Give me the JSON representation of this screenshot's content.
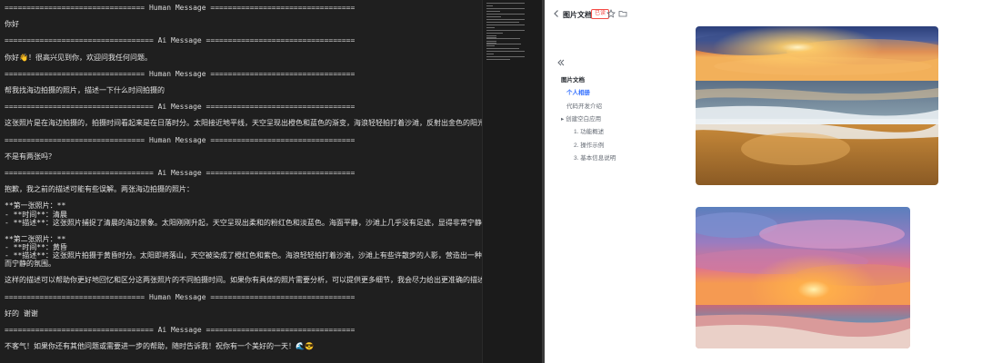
{
  "terminal": {
    "lines": [
      {
        "text": "================================ Human Message =================================",
        "kind": "sep"
      },
      {
        "text": "",
        "kind": "text"
      },
      {
        "text": "你好",
        "kind": "text"
      },
      {
        "text": "",
        "kind": "text"
      },
      {
        "text": "================================== Ai Message ==================================",
        "kind": "sep"
      },
      {
        "text": "",
        "kind": "text"
      },
      {
        "text": "你好👋！很高兴见到你，欢迎问我任何问题。",
        "kind": "text"
      },
      {
        "text": "",
        "kind": "text"
      },
      {
        "text": "================================ Human Message =================================",
        "kind": "sep"
      },
      {
        "text": "",
        "kind": "text"
      },
      {
        "text": "帮我找海边拍摄的照片，描述一下什么时间拍摄的",
        "kind": "text"
      },
      {
        "text": "",
        "kind": "text"
      },
      {
        "text": "================================== Ai Message ==================================",
        "kind": "sep"
      },
      {
        "text": "",
        "kind": "text"
      },
      {
        "text": "这张照片是在海边拍摄的，拍摄时间看起来是在日落时分。太阳接近地平线，天空呈现出橙色和蓝色的渐变，海浪轻轻拍打着沙滩，反射出金色的阳光。",
        "kind": "text"
      },
      {
        "text": "",
        "kind": "text"
      },
      {
        "text": "================================ Human Message =================================",
        "kind": "sep"
      },
      {
        "text": "",
        "kind": "text"
      },
      {
        "text": "不是有两张吗？",
        "kind": "text"
      },
      {
        "text": "",
        "kind": "text"
      },
      {
        "text": "================================== Ai Message ==================================",
        "kind": "sep"
      },
      {
        "text": "",
        "kind": "text"
      },
      {
        "text": "抱歉，我之前的描述可能有些误解。两张海边拍摄的照片：",
        "kind": "text"
      },
      {
        "text": "",
        "kind": "text"
      },
      {
        "text": "**第一张照片：**",
        "kind": "text"
      },
      {
        "text": "- **时间**：清晨",
        "kind": "text"
      },
      {
        "text": "- **描述**：这张照片捕捉了清晨的海边景象。太阳刚刚升起，天空呈现出柔和的粉红色和淡蓝色。海面平静，沙滩上几乎没有足迹，显得非常宁静。",
        "kind": "text"
      },
      {
        "text": "",
        "kind": "text"
      },
      {
        "text": "**第二张照片：**",
        "kind": "text"
      },
      {
        "text": "- **时间**：黄昏",
        "kind": "text"
      },
      {
        "text": "- **描述**：这张照片拍摄于黄昏时分。太阳即将落山，天空被染成了橙红色和紫色。海浪轻轻拍打着沙滩，沙滩上有些许散步的人影，营造出一种温馨",
        "kind": "text"
      },
      {
        "text": "而宁静的氛围。",
        "kind": "text"
      },
      {
        "text": "",
        "kind": "text"
      },
      {
        "text": "这样的描述可以帮助你更好地回忆和区分这两张照片的不同拍摄时间。如果你有具体的照片需要分析，可以提供更多细节，我会尽力给出更准确的描述。",
        "kind": "text"
      },
      {
        "text": "",
        "kind": "text"
      },
      {
        "text": "================================ Human Message =================================",
        "kind": "sep"
      },
      {
        "text": "",
        "kind": "text"
      },
      {
        "text": "好的 谢谢",
        "kind": "text"
      },
      {
        "text": "",
        "kind": "text"
      },
      {
        "text": "================================== Ai Message ==================================",
        "kind": "sep"
      },
      {
        "text": "",
        "kind": "text"
      },
      {
        "text": "不客气！如果你还有其他问题或需要进一步的帮助，随时告诉我！祝你有一个美好的一天！🌊😎",
        "kind": "text"
      }
    ]
  },
  "doc": {
    "title": "图片文档",
    "badge": "已读",
    "icons": {
      "back": "chevron-left-icon",
      "star": "star-icon",
      "folder": "folder-icon",
      "collapse": "double-chevron-left-icon"
    },
    "outline": [
      {
        "label": "图片文档",
        "level": 0,
        "active": false,
        "bullet": false
      },
      {
        "label": "个人相册",
        "level": 1,
        "active": true,
        "bullet": false
      },
      {
        "label": "代码开发介绍",
        "level": 1,
        "active": false,
        "bullet": false
      },
      {
        "label": "创建空白应用",
        "level": 1,
        "active": false,
        "bullet": true
      },
      {
        "label": "1. 功能概述",
        "level": 2,
        "active": false,
        "bullet": false
      },
      {
        "label": "2. 操作示例",
        "level": 2,
        "active": false,
        "bullet": false
      },
      {
        "label": "3. 基本信息说明",
        "level": 2,
        "active": false,
        "bullet": false
      }
    ],
    "images": [
      {
        "name": "sunset-beach-photo"
      },
      {
        "name": "dusk-beach-photo"
      }
    ],
    "colors": {
      "accent": "#3370ff",
      "badge": "#f54a45"
    }
  }
}
